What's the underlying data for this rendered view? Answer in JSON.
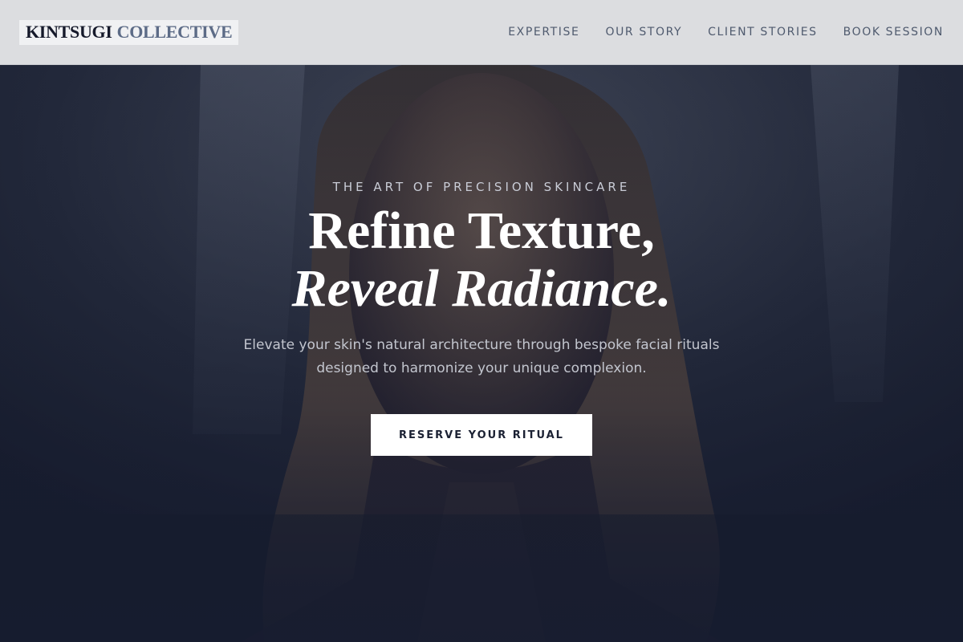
{
  "brand": {
    "name_part1": "KINTSUGI",
    "name_part2": "COLLECTIVE"
  },
  "nav": {
    "items": [
      {
        "label": "EXPERTISE"
      },
      {
        "label": "OUR STORY"
      },
      {
        "label": "CLIENT STORIES"
      },
      {
        "label": "BOOK SESSION"
      }
    ]
  },
  "hero": {
    "eyebrow": "THE ART OF PRECISION SKINCARE",
    "headline_line1": "Refine Texture,",
    "headline_line2": "Reveal Radiance.",
    "subtitle": "Elevate your skin's natural architecture through bespoke facial rituals designed to harmonize your unique complexion.",
    "cta_label": "RESERVE YOUR RITUAL",
    "image_icon": "portrait-photo"
  },
  "colors": {
    "header_bg": "#dcdde0",
    "logo_dark": "#15192a",
    "logo_accent": "#5c6b86",
    "nav_text": "#4f5a6e",
    "hero_overlay": "#1b2133",
    "cta_bg": "#ffffff",
    "cta_text": "#1b2133"
  }
}
